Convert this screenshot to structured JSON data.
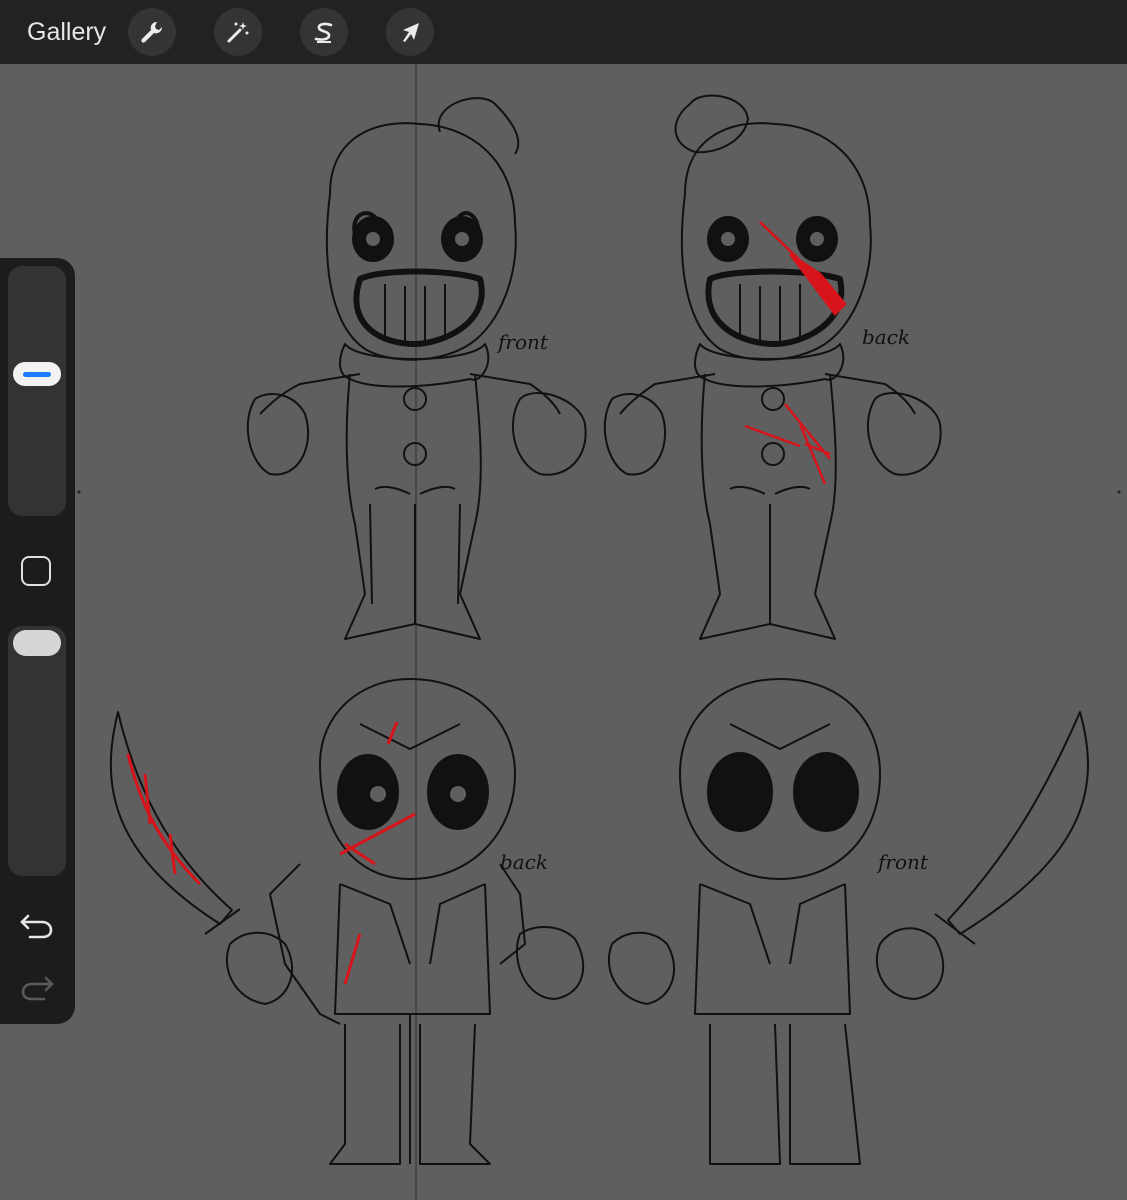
{
  "toolbar": {
    "gallery_label": "Gallery",
    "tools": [
      {
        "name": "actions-wrench-icon"
      },
      {
        "name": "adjustments-magic-wand-icon"
      },
      {
        "name": "selection-s-icon"
      },
      {
        "name": "transform-arrow-icon"
      }
    ]
  },
  "sidebar": {
    "brush_size_slider": "brush-size",
    "modify_button": "square",
    "opacity_slider": "opacity",
    "undo": "undo",
    "redo": "redo"
  },
  "canvas": {
    "labels": {
      "clown_front": "front",
      "clown_back": "back",
      "jason_back": "back",
      "jason_front": "front"
    },
    "colors": {
      "background": "#5f5f5f",
      "line": "#111111",
      "blood": "#d8141b",
      "accent": "#1a7cff"
    }
  }
}
